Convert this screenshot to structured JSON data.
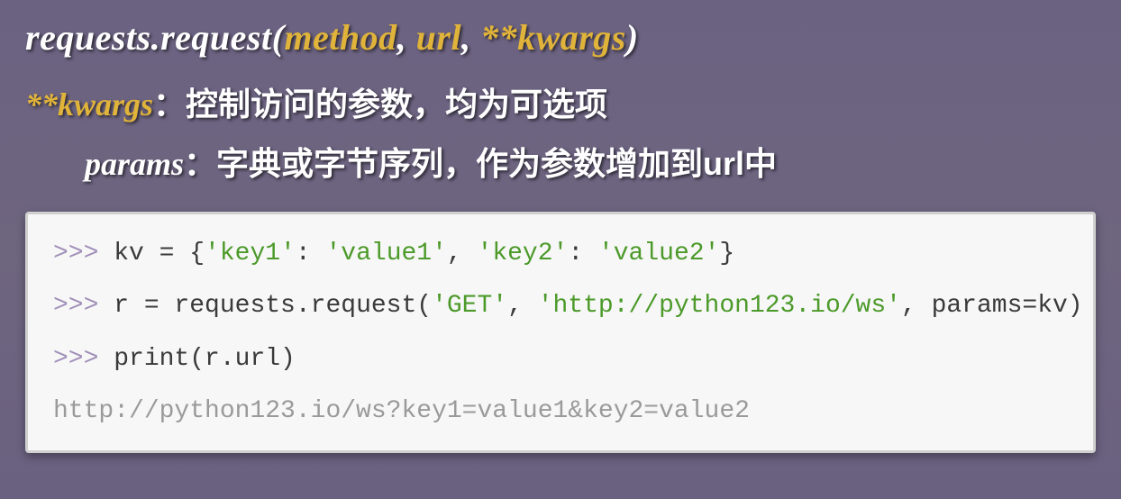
{
  "signature": {
    "prefix": "requests.request(",
    "arg1": "method",
    "sep1": ", ",
    "arg2": "url",
    "sep2": ", ",
    "arg3": "**kwargs",
    "close": ")"
  },
  "desc": {
    "kwargs_label": "**kwargs",
    "kwargs_colon": "：",
    "kwargs_text": "控制访问的参数，均为可选项",
    "params_label": "params",
    "params_colon": "：",
    "params_text": "字典或字节序列，作为参数增加到url中"
  },
  "code": {
    "prompt": ">>> ",
    "l1": {
      "a": "kv = {",
      "s1": "'key1'",
      "b": ": ",
      "s2": "'value1'",
      "c": ", ",
      "s3": "'key2'",
      "d": ": ",
      "s4": "'value2'",
      "e": "}"
    },
    "l2": {
      "a": "r = requests.request(",
      "s1": "'GET'",
      "b": ", ",
      "s2": "'http://python123.io/ws'",
      "c": ", params=kv)"
    },
    "l3": {
      "a": "print(r.url)"
    },
    "output": "http://python123.io/ws?key1=value1&key2=value2"
  }
}
